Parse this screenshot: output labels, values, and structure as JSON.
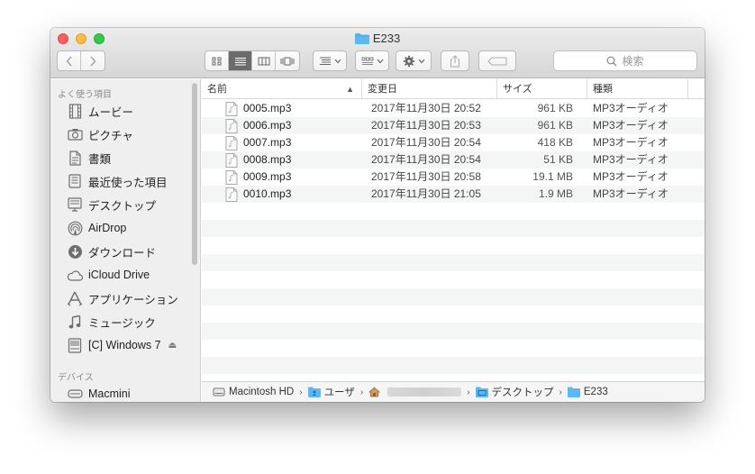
{
  "window": {
    "title": "E233",
    "search_placeholder": "検索"
  },
  "sidebar": {
    "favorites_heading": "よく使う項目",
    "favorites": [
      {
        "label": "ムービー",
        "icon": "film-icon"
      },
      {
        "label": "ピクチャ",
        "icon": "camera-icon"
      },
      {
        "label": "書類",
        "icon": "document-icon"
      },
      {
        "label": "最近使った項目",
        "icon": "recents-icon"
      },
      {
        "label": "デスクトップ",
        "icon": "desktop-icon"
      },
      {
        "label": "AirDrop",
        "icon": "airdrop-icon"
      },
      {
        "label": "ダウンロード",
        "icon": "download-icon"
      },
      {
        "label": "iCloud Drive",
        "icon": "cloud-icon"
      },
      {
        "label": "アプリケーション",
        "icon": "applications-icon"
      },
      {
        "label": "ミュージック",
        "icon": "music-icon"
      },
      {
        "label": "[C] Windows 7",
        "icon": "disk-icon",
        "eject": "⏏"
      }
    ],
    "devices_heading": "デバイス",
    "devices": [
      {
        "label": "Macmini",
        "icon": "harddrive-icon"
      }
    ]
  },
  "columns": {
    "name": "名前",
    "date": "変更日",
    "size": "サイズ",
    "kind": "種類"
  },
  "files": [
    {
      "name": "0005.mp3",
      "date": "2017年11月30日 20:52",
      "size": "961 KB",
      "kind": "MP3オーディオ"
    },
    {
      "name": "0006.mp3",
      "date": "2017年11月30日 20:53",
      "size": "961 KB",
      "kind": "MP3オーディオ"
    },
    {
      "name": "0007.mp3",
      "date": "2017年11月30日 20:54",
      "size": "418 KB",
      "kind": "MP3オーディオ"
    },
    {
      "name": "0008.mp3",
      "date": "2017年11月30日 20:54",
      "size": "51 KB",
      "kind": "MP3オーディオ"
    },
    {
      "name": "0009.mp3",
      "date": "2017年11月30日 20:58",
      "size": "19.1 MB",
      "kind": "MP3オーディオ"
    },
    {
      "name": "0010.mp3",
      "date": "2017年11月30日 21:05",
      "size": "1.9 MB",
      "kind": "MP3オーディオ"
    }
  ],
  "pathbar": {
    "disk": "Macintosh HD",
    "users": "ユーザ",
    "desktop": "デスクトップ",
    "folder": "E233"
  },
  "colors": {
    "folder_blue": "#5cb8f0",
    "close": "#fc605c",
    "minimize": "#fdbc40",
    "zoom": "#34c84a"
  }
}
